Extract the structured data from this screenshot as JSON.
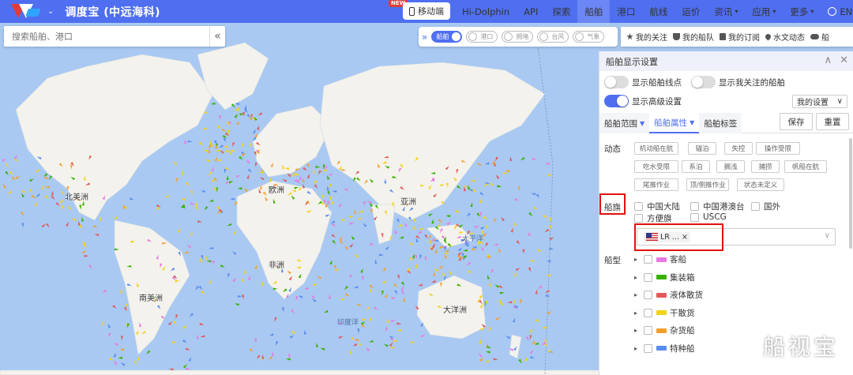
{
  "header": {
    "brand": "调度宝 (中远海科)",
    "new_badge": "NEW",
    "mobile_label": "移动端",
    "nav": [
      {
        "label": "Hi-Dolphin",
        "caret": false,
        "active": false
      },
      {
        "label": "API",
        "caret": false,
        "active": false
      },
      {
        "label": "探索",
        "caret": false,
        "active": false
      },
      {
        "label": "船舶",
        "caret": false,
        "active": true
      },
      {
        "label": "港口",
        "caret": false,
        "active": false
      },
      {
        "label": "航线",
        "caret": false,
        "active": false
      },
      {
        "label": "运价",
        "caret": false,
        "active": false
      },
      {
        "label": "资讯",
        "caret": true,
        "active": false
      },
      {
        "label": "应用",
        "caret": true,
        "active": false
      },
      {
        "label": "更多",
        "caret": true,
        "active": false
      }
    ],
    "lang": "EN"
  },
  "search": {
    "placeholder": "搜索船舶、港口",
    "collapse": "«"
  },
  "layers": {
    "expand": "»",
    "toggles": [
      {
        "label": "船舶",
        "on": true
      },
      {
        "label": "港口",
        "on": false
      },
      {
        "label": "拥堵",
        "on": false
      },
      {
        "label": "台风",
        "on": false
      },
      {
        "label": "气象",
        "on": false
      }
    ]
  },
  "quickbar": [
    "我的关注",
    "我的船队",
    "我的订阅",
    "水文动态",
    "船"
  ],
  "map": {
    "continents": [
      {
        "label": "北美洲"
      },
      {
        "label": "欧洲"
      },
      {
        "label": "亚洲"
      },
      {
        "label": "非洲"
      },
      {
        "label": "南美洲"
      },
      {
        "label": "大洋洲"
      }
    ],
    "oceans": [
      "太平洋",
      "印度洋"
    ]
  },
  "panel": {
    "title": "船舶显示设置",
    "toggles": [
      {
        "label": "显示船舶线点",
        "on": false
      },
      {
        "label": "显示我关注的船舶",
        "on": false
      },
      {
        "label": "显示高级设置",
        "on": true
      }
    ],
    "my_settings": "我的设置",
    "tabs": [
      {
        "label": "船舶范围",
        "tri": true,
        "active": false
      },
      {
        "label": "船舶属性",
        "tri": true,
        "active": true
      },
      {
        "label": "船舶标签",
        "tri": false,
        "active": false
      }
    ],
    "save": "保存",
    "reset": "重置",
    "status_label": "动态",
    "status_chips": [
      "机动船在航",
      "锚泊",
      "失控",
      "操作受限",
      "吃水受限",
      "系泊",
      "搁浅",
      "捕捞",
      "帆船在航",
      "尾推作业",
      "顶/侧推作业",
      "状态未定义"
    ],
    "flag_label": "船旗",
    "flag_options": [
      "中国大陆",
      "中国港澳台",
      "国外",
      "方便旗",
      "USCG"
    ],
    "flag_selected_tag": "LR ...",
    "flag_tag_close": "×",
    "shiptype_label": "船型",
    "ship_types": [
      {
        "label": "客船",
        "color": "#e57be0"
      },
      {
        "label": "集装箱",
        "color": "#38b000"
      },
      {
        "label": "液体散货",
        "color": "#e05a5a"
      },
      {
        "label": "干散货",
        "color": "#f2d21b"
      },
      {
        "label": "杂货船",
        "color": "#f0a030"
      },
      {
        "label": "特种船",
        "color": "#5b8cf0"
      }
    ]
  },
  "watermark": "船视宝",
  "colors": {
    "accent": "#4f6ff0",
    "highlight": "#e01010"
  }
}
